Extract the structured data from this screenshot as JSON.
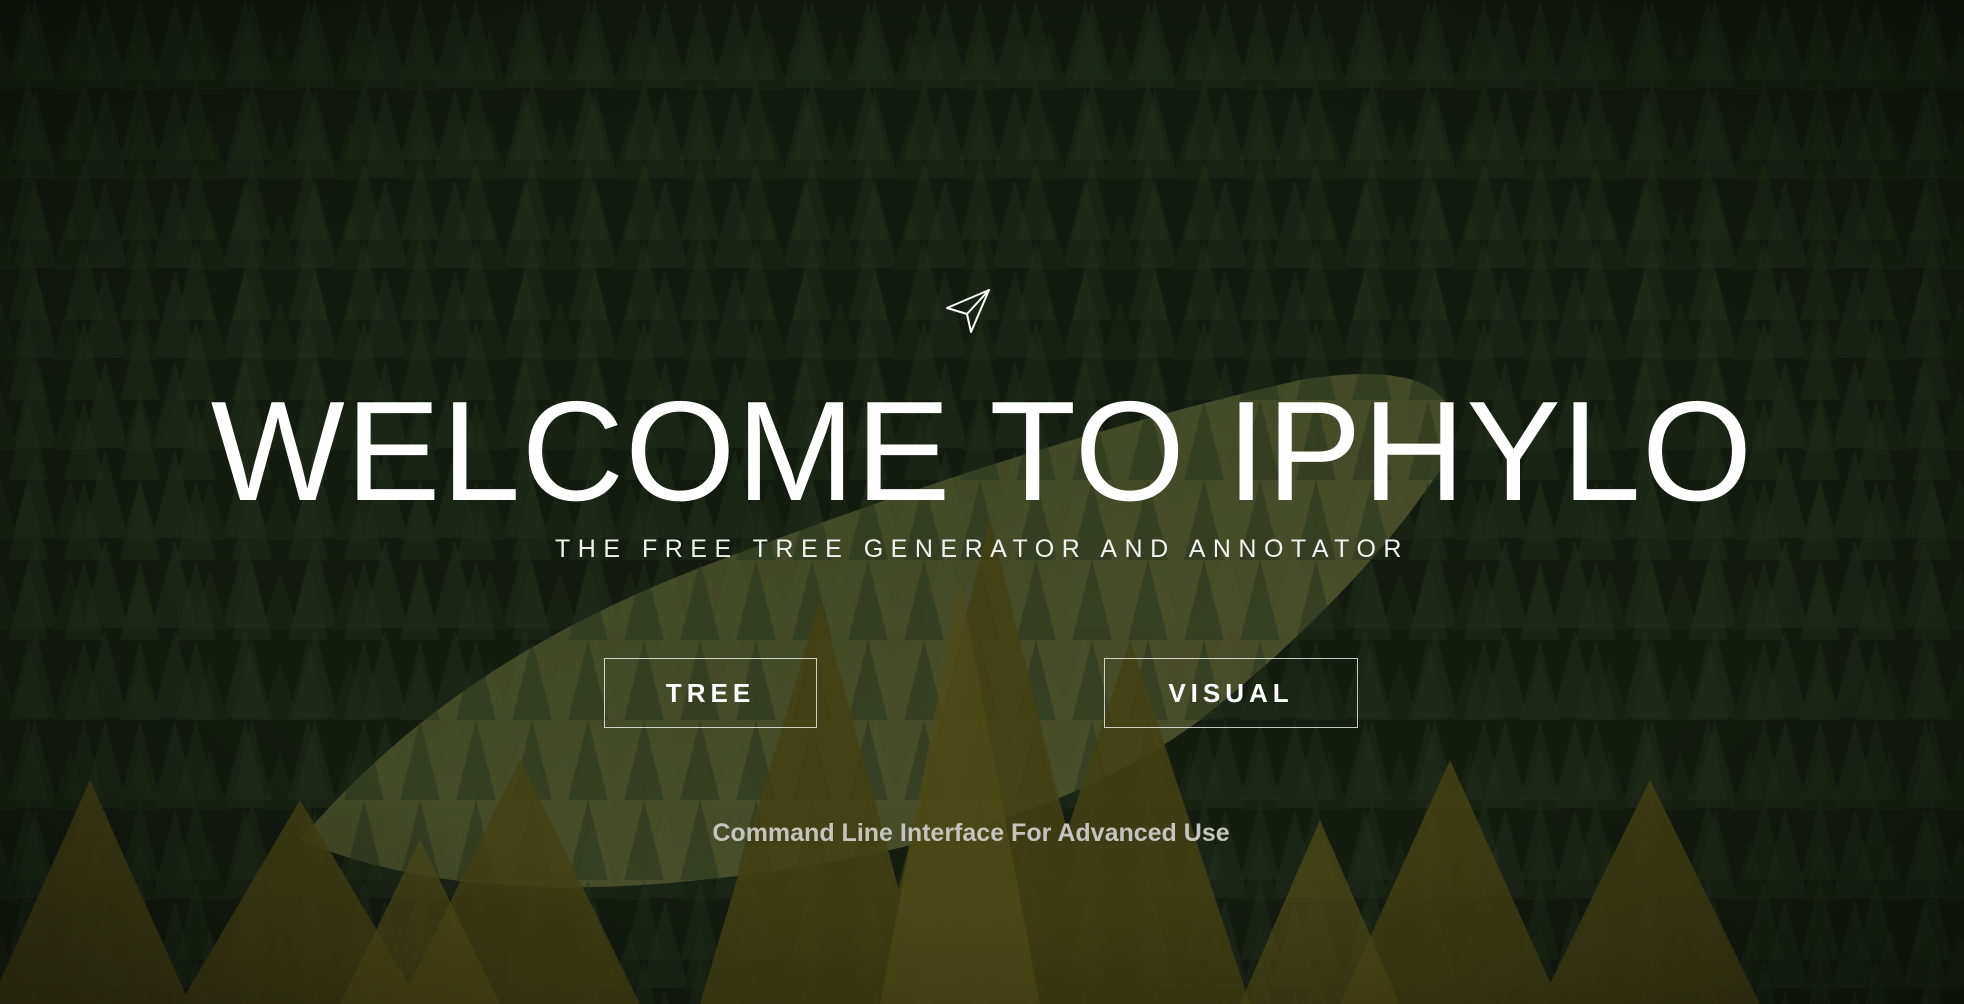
{
  "hero": {
    "title": "WELCOME TO IPHYLO",
    "subtitle": "THE FREE TREE GENERATOR AND ANNOTATOR",
    "logo_icon": "paper-plane-icon",
    "background": "forest-photo"
  },
  "actions": {
    "tree_label": "TREE",
    "visual_label": "VISUAL"
  },
  "footer": {
    "cli_link": "Command Line Interface For Advanced Use"
  },
  "colors": {
    "text": "#ffffff",
    "muted_text": "#c4c4bc",
    "forest_dark": "#1a2212",
    "meadow": "#6f7a3c"
  }
}
